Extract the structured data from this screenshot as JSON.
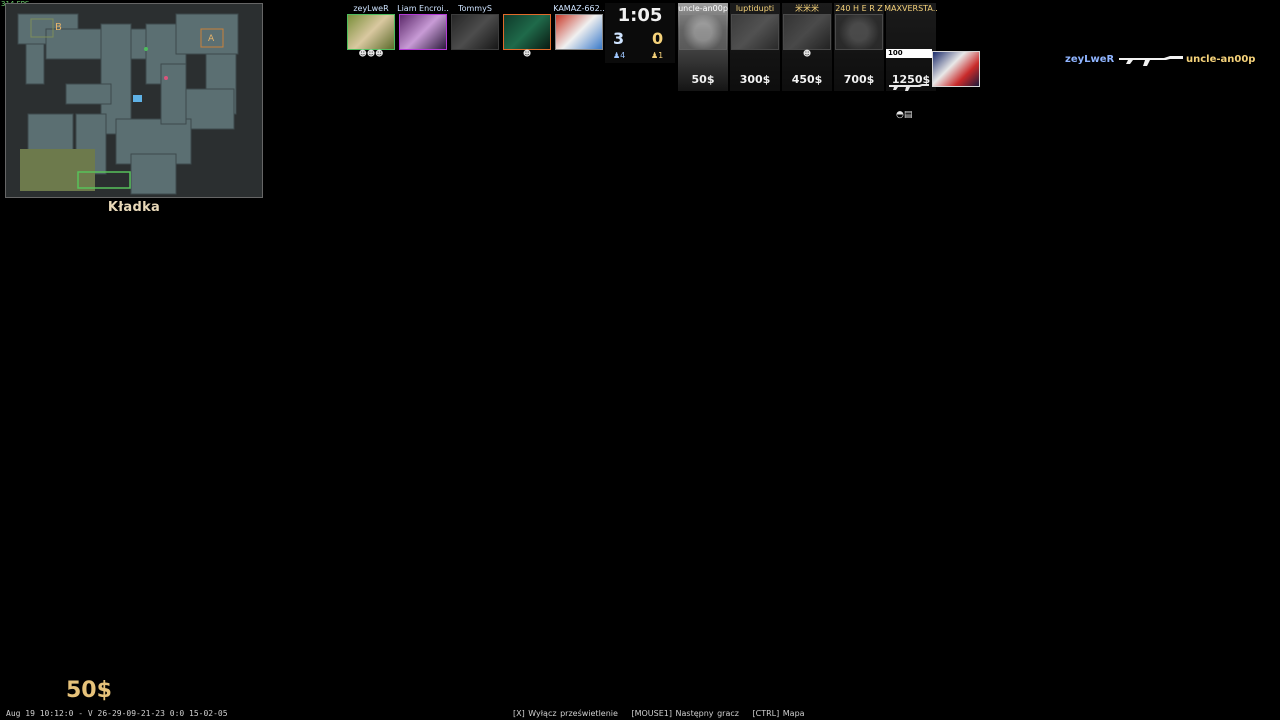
{
  "hud": {
    "fps": "314 FPS",
    "location": "Kładka",
    "timer": "1:05",
    "score_ct": "3",
    "score_t": "0",
    "alive_ct": "♟4",
    "alive_t": "♟1",
    "money": "50$",
    "demo_info": "Aug 19 10:12:0 - V 26-29-09-21-23 0:0 15-02-05"
  },
  "radar": {
    "site_a": "A",
    "site_b": "B"
  },
  "ct_players": [
    {
      "name": "zeyLweR",
      "kills": "☻☻☻"
    },
    {
      "name": "Liam Encroi..",
      "kills": ""
    },
    {
      "name": "TommyS",
      "kills": ""
    },
    {
      "name": "",
      "kills": "☻"
    },
    {
      "name": "KAMAZ-662..",
      "kills": ""
    }
  ],
  "t_players": [
    {
      "name": "uncle-an00p",
      "money": "50$",
      "kills": ""
    },
    {
      "name": "luptidupti",
      "money": "300$",
      "kills": ""
    },
    {
      "name": "米米米",
      "money": "450$",
      "kills": "☻"
    },
    {
      "name": "240 H E R Z",
      "money": "700$",
      "kills": ""
    },
    {
      "name": "MAXVERSTA..",
      "money": "1250$",
      "kills": "",
      "hp": "100"
    }
  ],
  "killfeed": {
    "attacker": "zeyLweR",
    "weapon": "rifle-icon",
    "victim": "uncle-an00p"
  },
  "hints": {
    "toggle": "[X] Wyłącz prześwietlenie",
    "next": "[MOUSE1] Następny gracz",
    "map": "[CTRL] Mapa"
  },
  "colors": {
    "ct": "#8fb4ff",
    "t": "#f5d27a",
    "money": "#e6c27a"
  }
}
